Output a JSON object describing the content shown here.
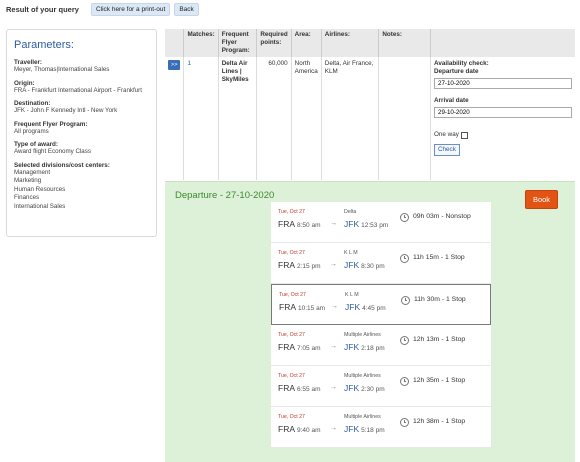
{
  "topbar": {
    "title": "Result of your query",
    "printout_label": "Click here for a print-out",
    "back_label": "Back"
  },
  "parameters": {
    "heading": "Parameters:",
    "traveller_label": "Traveller:",
    "traveller_value": "Meyer, Thomas|International Sales",
    "origin_label": "Origin:",
    "origin_value": "FRA - Frankfurt International Airport - Frankfurt",
    "destination_label": "Destination:",
    "destination_value": "JFK - John F Kennedy Intl - New York",
    "ffp_label": "Frequent Flyer Program:",
    "ffp_value": "All programs",
    "award_label": "Type of award:",
    "award_value": "Award flight Economy Class",
    "divisions_label": "Selected divisions/cost centers:",
    "divisions": [
      "Management",
      "Marketing",
      "Human Resources",
      "Finances",
      "International Sales"
    ]
  },
  "results": {
    "headers": {
      "matches": "Matches:",
      "program": "Frequent Flyer Program:",
      "points": "Required points:",
      "area": "Area:",
      "airlines": "Airlines:",
      "notes": "Notes:"
    },
    "row": {
      "expand": ">>",
      "match": "1",
      "program": "Delta Air Lines | SkyMiles",
      "points": "60,000",
      "area": "North America",
      "airlines": "Delta, Air France, KLM",
      "notes": ""
    },
    "availability": {
      "title": "Availability check:",
      "departure_label": "Departure date",
      "departure_value": "27-10-2020",
      "arrival_label": "Arrival date",
      "arrival_value": "29-10-2020",
      "oneway_label": "One way",
      "check_label": "Check"
    }
  },
  "departure": {
    "title": "Departure - 27-10-2020",
    "book_label": "Book",
    "flights": [
      {
        "date": "Tue, Oct 27",
        "from": "FRA",
        "dep_time": "8:50 am",
        "airline": "Delta",
        "to": "JFK",
        "arr_time": "12:53 pm",
        "duration": "09h 03m - Nonstop"
      },
      {
        "date": "Tue, Oct 27",
        "from": "FRA",
        "dep_time": "2:15 pm",
        "airline": "K L M",
        "to": "JFK",
        "arr_time": "8:30 pm",
        "duration": "11h 15m - 1 Stop"
      },
      {
        "date": "Tue, Oct 27",
        "from": "FRA",
        "dep_time": "10:15 am",
        "airline": "K L M",
        "to": "JFK",
        "arr_time": "4:45 pm",
        "duration": "11h 30m - 1 Stop"
      },
      {
        "date": "Tue, Oct 27",
        "from": "FRA",
        "dep_time": "7:05 am",
        "airline": "Multiple Airlines",
        "to": "JFK",
        "arr_time": "2:18 pm",
        "duration": "12h 13m - 1 Stop"
      },
      {
        "date": "Tue, Oct 27",
        "from": "FRA",
        "dep_time": "6:55 am",
        "airline": "Multiple Airlines",
        "to": "JFK",
        "arr_time": "2:30 pm",
        "duration": "12h 35m - 1 Stop"
      },
      {
        "date": "Tue, Oct 27",
        "from": "FRA",
        "dep_time": "9:40 am",
        "airline": "Multiple Airlines",
        "to": "JFK",
        "arr_time": "5:18 pm",
        "duration": "12h 38m - 1 Stop"
      }
    ]
  }
}
